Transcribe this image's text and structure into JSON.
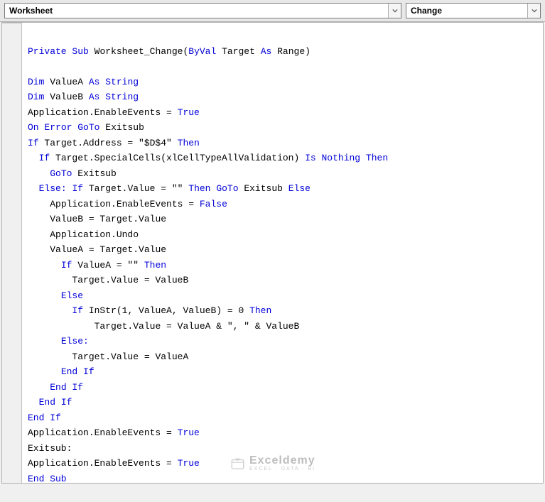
{
  "header": {
    "object_combo": "Worksheet",
    "proc_combo": "Change"
  },
  "code": {
    "t": {
      "private": "Private",
      "sub": "Sub",
      "byval": "ByVal",
      "as": "As",
      "dim": "Dim",
      "string": "String",
      "true": "True",
      "false": "False",
      "on": "On",
      "error": "Error",
      "goto": "GoTo",
      "if": "If",
      "then": "Then",
      "is": "Is",
      "nothing": "Nothing",
      "else": "Else",
      "elsec": "Else:",
      "endif": "End If",
      "endsub": "End Sub"
    },
    "ids": {
      "proc": "Worksheet_Change(",
      "target_as_range": " Target ",
      "range_close": " Range)",
      "valueA": " ValueA ",
      "valueB": " ValueB ",
      "app_enable_true": "Application.EnableEvents = ",
      "exitsub_ident": " Exitsub",
      "if_target_addr": " Target.Address = \"$D$4\" ",
      "if_special": " Target.SpecialCells(xlCellTypeAllValidation) ",
      "if_target_val_empty": " Target.Value = \"\" ",
      "app_enable_false": "Application.EnableEvents = ",
      "vb_assign": "ValueB = Target.Value",
      "app_undo": "Application.Undo",
      "va_assign": "ValueA = Target.Value",
      "if_va_empty": " ValueA = \"\" ",
      "tv_eq_vb": "Target.Value = ValueB",
      "instr": " InStr(1, ValueA, ValueB) = 0 ",
      "concat": "Target.Value = ValueA & \", \" & ValueB",
      "tv_eq_va": "Target.Value = ValueA",
      "exitsub_label": "Exitsub:"
    }
  },
  "watermark": {
    "main": "Exceldemy",
    "sub": "EXCEL · DATA · BI"
  }
}
